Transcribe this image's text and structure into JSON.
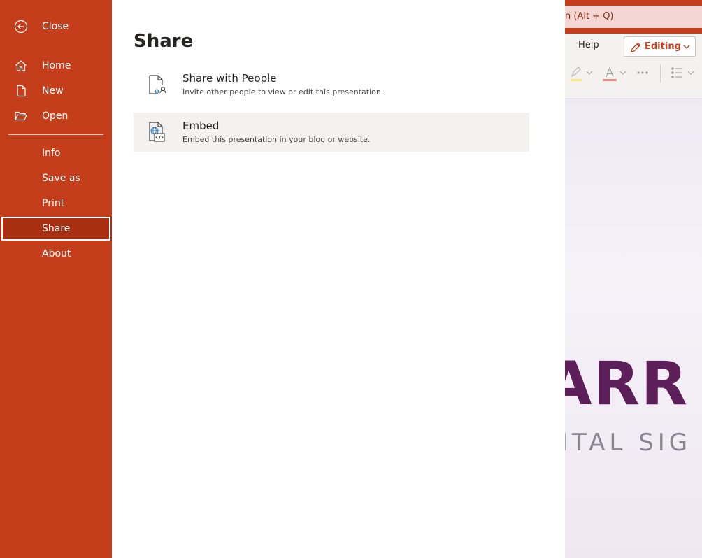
{
  "nav": {
    "close": "Close",
    "home": "Home",
    "new": "New",
    "open": "Open",
    "info": "Info",
    "save_as": "Save as",
    "print": "Print",
    "share": "Share",
    "about": "About",
    "selected": "Share"
  },
  "main": {
    "title": "Share",
    "options": [
      {
        "title": "Share with People",
        "desc": "Invite other people to view or edit this presentation.",
        "icon": "share-people-icon"
      },
      {
        "title": "Embed",
        "desc": "Embed this presentation in your blog or website.",
        "icon": "embed-icon"
      }
    ]
  },
  "background_app": {
    "search_text": "n (Alt + Q)",
    "help_tab": "Help",
    "editing_label": "Editing",
    "slide_logo_text": "ARR",
    "slide_sub_text": "ITAL SIG"
  },
  "colors": {
    "accent": "#c43e1c",
    "selected_nav": "#a92f12",
    "hover_option": "#f3f2f1",
    "logo_purple": "#5d1f5a"
  }
}
